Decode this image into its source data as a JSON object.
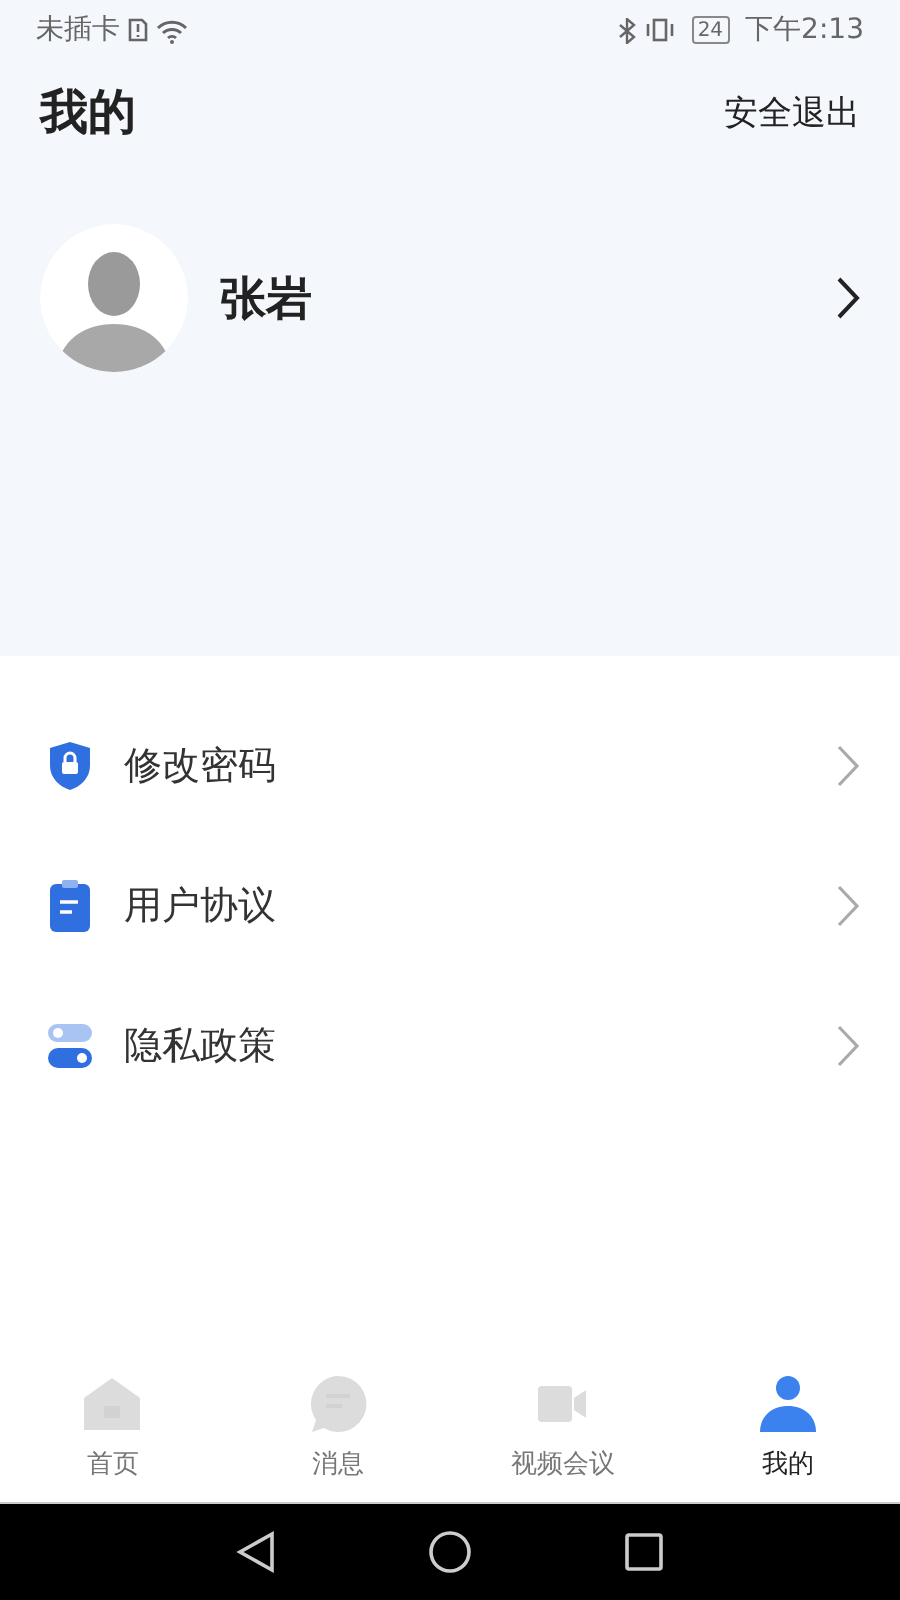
{
  "status_bar": {
    "carrier": "未插卡",
    "battery": "24",
    "time": "下午2:13"
  },
  "header": {
    "title": "我的",
    "logout": "安全退出"
  },
  "profile": {
    "name": "张岩"
  },
  "menu": [
    {
      "kind": "password",
      "label": "修改密码"
    },
    {
      "kind": "agreement",
      "label": "用户协议"
    },
    {
      "kind": "privacy",
      "label": "隐私政策"
    }
  ],
  "tabs": [
    {
      "kind": "home",
      "label": "首页",
      "selected": false
    },
    {
      "kind": "message",
      "label": "消息",
      "selected": false
    },
    {
      "kind": "video",
      "label": "视频会议",
      "selected": false
    },
    {
      "kind": "me",
      "label": "我的",
      "selected": true
    }
  ]
}
